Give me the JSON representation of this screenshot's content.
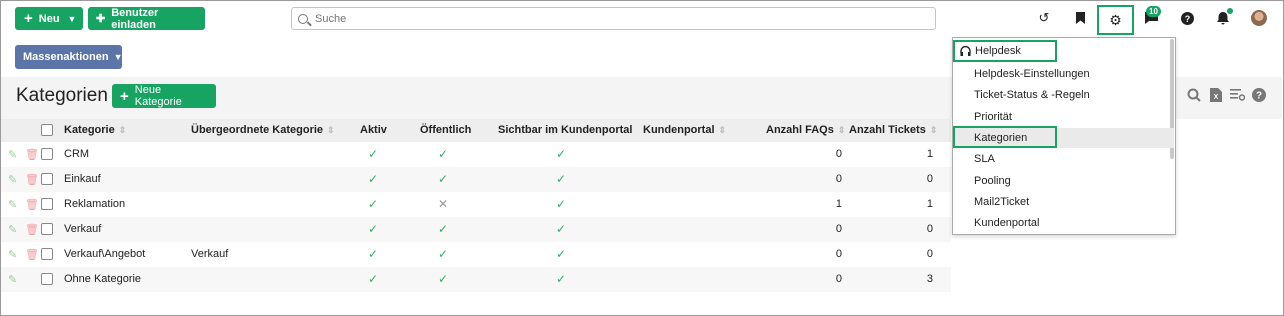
{
  "toolbar": {
    "new_label": "Neu",
    "invite_label": "Benutzer einladen",
    "search_placeholder": "Suche",
    "messages_badge": "10",
    "mass_actions_label": "Massenaktionen"
  },
  "page": {
    "title": "Kategorien",
    "new_category_label": "Neue Kategorie"
  },
  "table": {
    "headers": {
      "category": "Kategorie",
      "parent": "Übergeordnete Kategorie",
      "active": "Aktiv",
      "public": "Öffentlich",
      "portal_visible": "Sichtbar im Kundenportal",
      "portal": "Kundenportal",
      "faq_count": "Anzahl FAQs",
      "ticket_count": "Anzahl Tickets"
    },
    "rows": [
      {
        "name": "CRM",
        "parent": "",
        "active": true,
        "public": true,
        "portal_visible": true,
        "faqs": "0",
        "tickets": "1"
      },
      {
        "name": "Einkauf",
        "parent": "",
        "active": true,
        "public": true,
        "portal_visible": true,
        "faqs": "0",
        "tickets": "0"
      },
      {
        "name": "Reklamation",
        "parent": "",
        "active": true,
        "public": false,
        "portal_visible": true,
        "faqs": "1",
        "tickets": "1"
      },
      {
        "name": "Verkauf",
        "parent": "",
        "active": true,
        "public": true,
        "portal_visible": true,
        "faqs": "0",
        "tickets": "0"
      },
      {
        "name": "Verkauf\\Angebot",
        "parent": "Verkauf",
        "active": true,
        "public": true,
        "portal_visible": true,
        "faqs": "0",
        "tickets": "0"
      },
      {
        "name": "Ohne Kategorie",
        "parent": "",
        "active": true,
        "public": true,
        "portal_visible": true,
        "faqs": "0",
        "tickets": "3"
      }
    ]
  },
  "settings_menu": {
    "section_title": "Helpdesk",
    "items": [
      "Helpdesk-Einstellungen",
      "Ticket-Status & -Regeln",
      "Priorität",
      "Kategorien",
      "SLA",
      "Pooling",
      "Mail2Ticket",
      "Kundenportal"
    ],
    "highlighted": "Kategorien"
  },
  "colors": {
    "primary_green": "#17a463",
    "mass_actions_blue": "#5b75a8",
    "check_green": "#2eae6a"
  }
}
